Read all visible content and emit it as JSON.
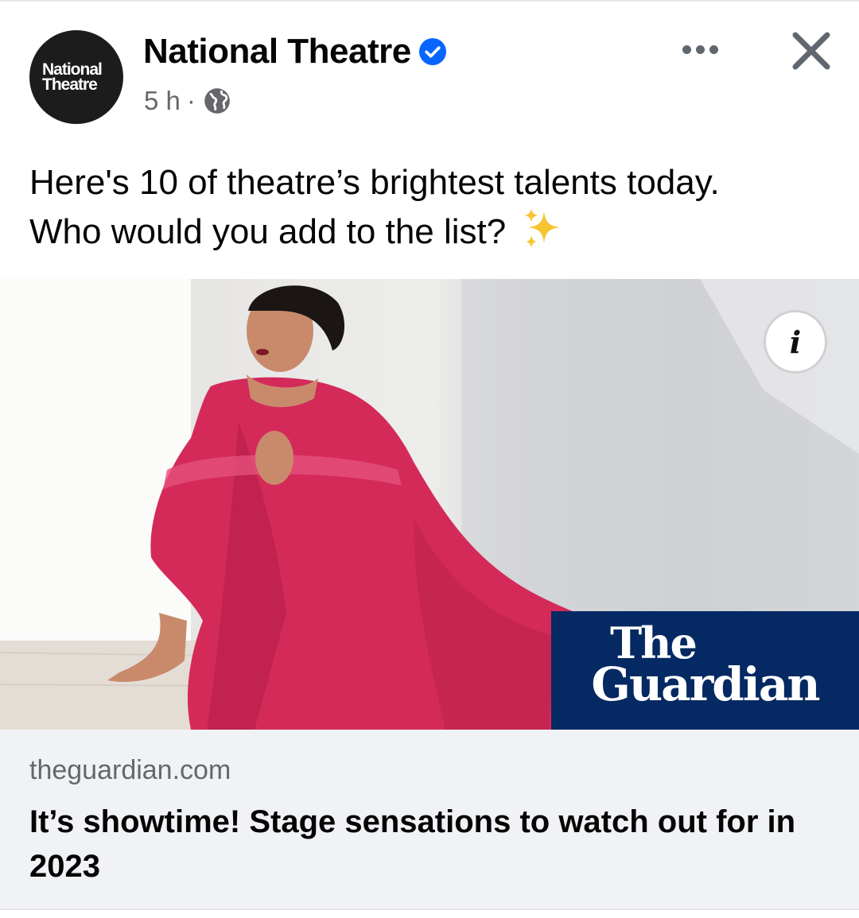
{
  "post": {
    "author": {
      "name": "National Theatre",
      "avatar_line1": "National",
      "avatar_line2": "Theatre",
      "verified": true
    },
    "meta": {
      "time": "5 h",
      "separator": "·",
      "audience_icon": "globe-icon"
    },
    "text_line1": "Here's 10 of theatre’s brightest talents today.",
    "text_line2": "Who would you add to the list?",
    "emoji": "sparkles",
    "actions": {
      "more_icon": "more-horizontal-icon",
      "close_icon": "close-icon"
    },
    "link_preview": {
      "image_description_icon": "info-icon",
      "info_label": "i",
      "publisher_logo_line1": "The",
      "publisher_logo_line2": "Guardian",
      "domain": "theguardian.com",
      "headline": "It’s showtime! Stage sensations to watch out for in 2023"
    }
  },
  "colors": {
    "verified_blue": "#0866ff",
    "guardian_blue": "#052962",
    "secondary_text": "#65676b",
    "link_bg": "#f0f2f5",
    "dress_red": "#d42a5a"
  }
}
